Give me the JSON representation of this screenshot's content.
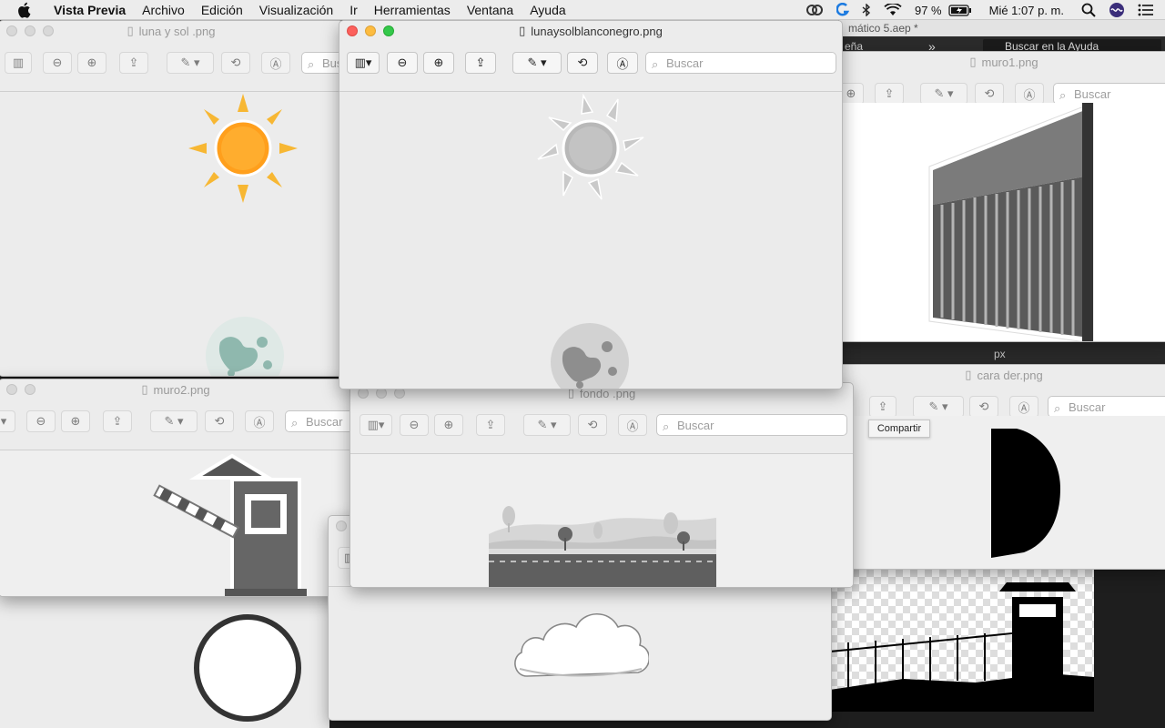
{
  "menubar": {
    "app_name": "Vista Previa",
    "items": [
      "Archivo",
      "Edición",
      "Visualización",
      "Ir",
      "Herramientas",
      "Ventana",
      "Ayuda"
    ],
    "battery": "97 %",
    "clock": "Mié 1:07 p. m."
  },
  "windows": {
    "luna_sol": {
      "title": "luna y sol .png",
      "search": "Buscar"
    },
    "lunaysol_bn": {
      "title": "lunaysolblanconegro.png",
      "search": "Buscar"
    },
    "muro1": {
      "title": "muro1.png",
      "search": "Buscar"
    },
    "muro2": {
      "title": "muro2.png",
      "search": "Buscar"
    },
    "fondo": {
      "title": "fondo .png",
      "search": "Buscar"
    },
    "cara_der": {
      "title": "cara der.png",
      "search": "Buscar"
    }
  },
  "background_app": {
    "project_title": "mático 5.aep *",
    "panel_fragment": "eña",
    "help_search": "Buscar en la Ayuda",
    "unit": "px"
  },
  "tooltip": "Compartir",
  "colors": {
    "menubar_bg": "#ececec",
    "window_bg": "#ececec",
    "close": "#fc605c",
    "minimize": "#fdbc40",
    "zoom": "#34c84a",
    "sun": "#ff9f1c",
    "sun_rays": "#f7b733",
    "moon": "#8fb8ae"
  },
  "icons": [
    "apple-icon",
    "sidebar-icon",
    "zoom-out-icon",
    "zoom-in-icon",
    "share-icon",
    "markup-pen-icon",
    "rotate-icon",
    "annotate-icon",
    "search-icon",
    "wifi-icon",
    "battery-icon",
    "spotlight-icon",
    "siri-icon",
    "notification-center-icon",
    "document-icon"
  ]
}
